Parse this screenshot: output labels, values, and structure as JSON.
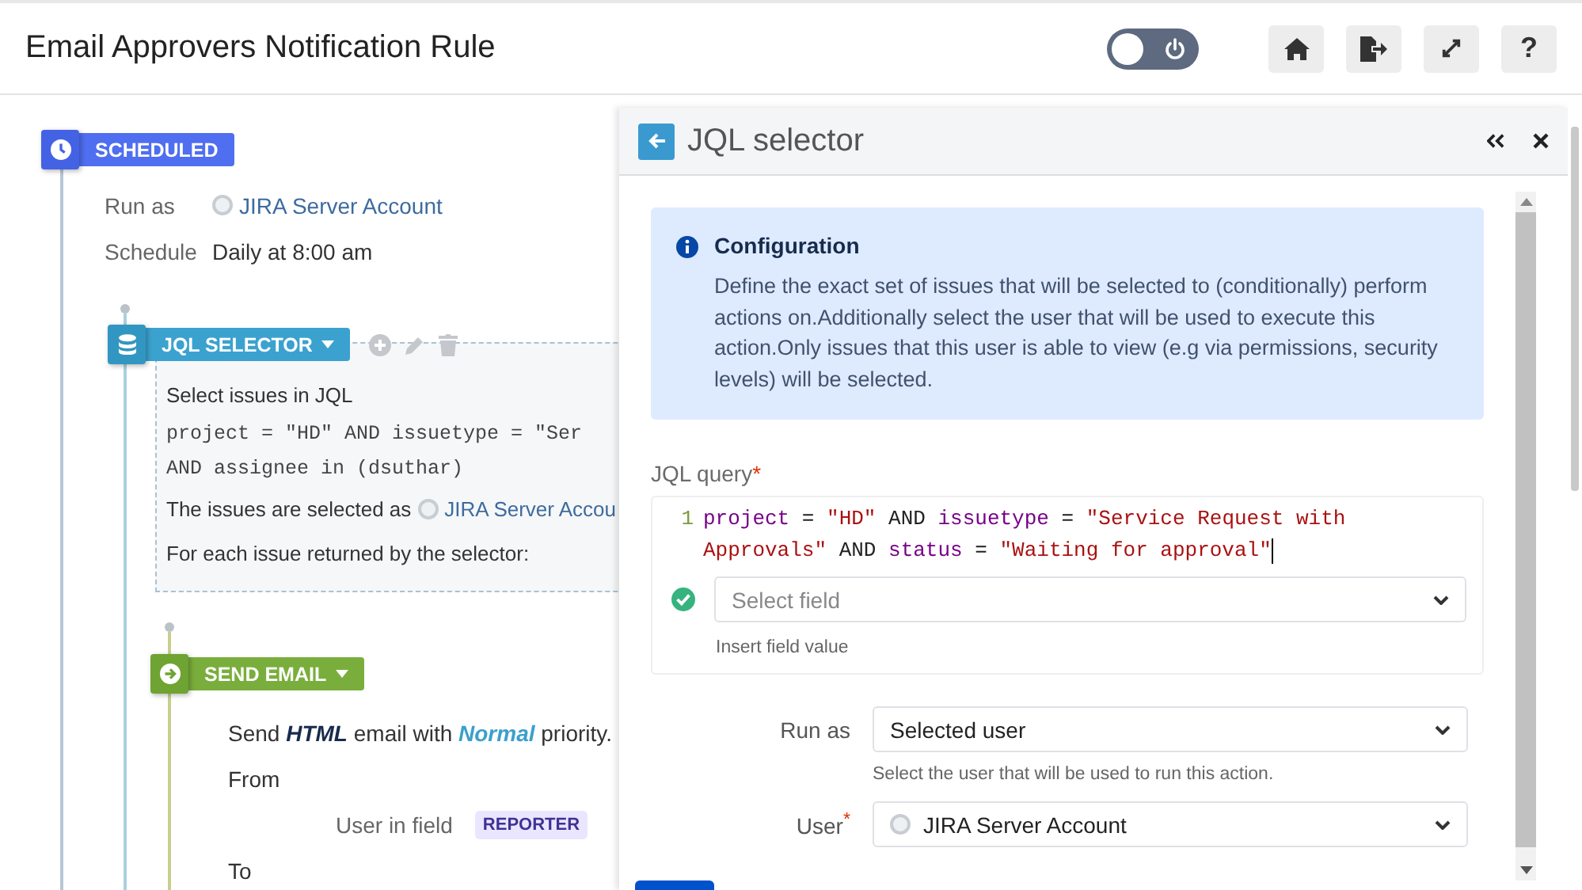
{
  "header": {
    "title": "Email Approvers Notification Rule",
    "toggle": {
      "on": false
    },
    "buttons": [
      {
        "kind": "home"
      },
      {
        "kind": "export"
      },
      {
        "kind": "expand"
      },
      {
        "kind": "help",
        "label": "?"
      }
    ]
  },
  "flow": {
    "trigger": {
      "label": "SCHEDULED",
      "fields": [
        {
          "label": "Run as",
          "value": "JIRA Server Account",
          "kind": "user"
        },
        {
          "label": "Schedule",
          "value": "Daily at 8:00 am",
          "kind": "text"
        }
      ]
    },
    "selector": {
      "label": "JQL SELECTOR",
      "title": "Select issues in JQL",
      "query_lines": [
        "project = \"HD\" AND issuetype = \"Ser",
        "AND assignee in (dsuthar)"
      ],
      "selected_as": "The issues are selected as",
      "selected_user": "JIRA Server Accou",
      "for_each": "For each issue returned by the selector:"
    },
    "action": {
      "label": "SEND EMAIL",
      "summary": [
        {
          "text": "Send ",
          "kind": "plain"
        },
        {
          "text": "HTML",
          "kind": "format"
        },
        {
          "text": " email with ",
          "kind": "plain"
        },
        {
          "text": "Normal",
          "kind": "priority"
        },
        {
          "text": " priority.",
          "kind": "plain"
        }
      ],
      "from_label": "From",
      "from_source": "User in field",
      "from_field": "REPORTER",
      "to_label": "To"
    }
  },
  "panel": {
    "title": "JQL selector",
    "info": {
      "title": "Configuration",
      "text": "Define the exact set of issues that will be selected to (conditionally) perform actions on.Additionally select the user that will be used to execute this action.Only issues that this user is able to view (e.g via permissions, security levels) will be selected."
    },
    "query_label": "JQL query",
    "query_required_mark": "*",
    "query": {
      "line_number": "1",
      "lines": [
        [
          {
            "text": "project",
            "kind": "field"
          },
          {
            "text": " = ",
            "kind": "op"
          },
          {
            "text": "\"HD\"",
            "kind": "string"
          },
          {
            "text": " AND ",
            "kind": "op"
          },
          {
            "text": "issuetype",
            "kind": "field"
          },
          {
            "text": " = ",
            "kind": "op"
          },
          {
            "text": "\"Service Request with",
            "kind": "string"
          }
        ],
        [
          {
            "text": "Approvals\"",
            "kind": "string"
          },
          {
            "text": " AND ",
            "kind": "op"
          },
          {
            "text": "status",
            "kind": "field"
          },
          {
            "text": " = ",
            "kind": "op"
          },
          {
            "text": "\"Waiting for approval\"",
            "kind": "string"
          }
        ]
      ]
    },
    "valid": true,
    "field_select": {
      "placeholder": "Select field"
    },
    "field_hint": "Insert field value",
    "run_as": {
      "label": "Run as",
      "value": "Selected user",
      "hint": "Select the user that will be used to run this action."
    },
    "user": {
      "label": "User",
      "required_mark": "*",
      "value": "JIRA Server Account"
    }
  }
}
